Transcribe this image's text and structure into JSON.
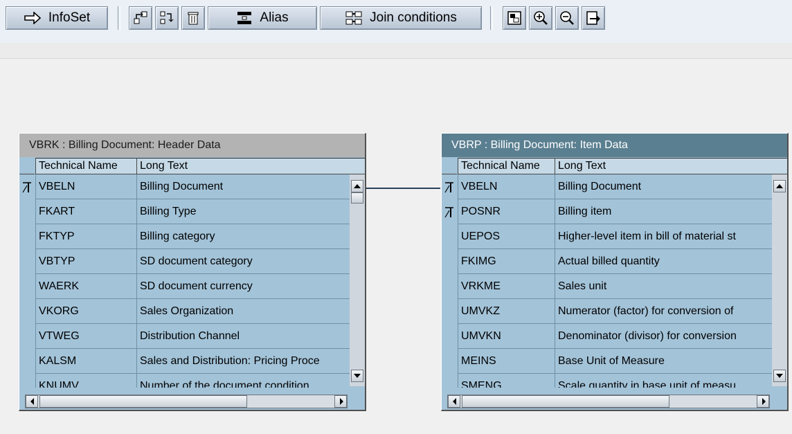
{
  "toolbar": {
    "infoset_label": "InfoSet",
    "alias_label": "Alias",
    "join_conditions_label": "Join conditions"
  },
  "left_table": {
    "title": "VBRK : Billing Document: Header Data",
    "columns": [
      "Technical Name",
      "Long Text"
    ],
    "rows": [
      {
        "tech": "VBELN",
        "text": "Billing Document",
        "key": true
      },
      {
        "tech": "FKART",
        "text": "Billing Type",
        "key": false
      },
      {
        "tech": "FKTYP",
        "text": "Billing category",
        "key": false
      },
      {
        "tech": "VBTYP",
        "text": "SD document category",
        "key": false
      },
      {
        "tech": "WAERK",
        "text": "SD document currency",
        "key": false
      },
      {
        "tech": "VKORG",
        "text": "Sales Organization",
        "key": false
      },
      {
        "tech": "VTWEG",
        "text": "Distribution Channel",
        "key": false
      },
      {
        "tech": "KALSM",
        "text": "Sales and Distribution: Pricing Proce",
        "key": false
      },
      {
        "tech": "KNUMV",
        "text": "Number of the document condition",
        "key": false
      }
    ]
  },
  "right_table": {
    "title": "VBRP : Billing Document: Item Data",
    "columns": [
      "Technical Name",
      "Long Text"
    ],
    "rows": [
      {
        "tech": "VBELN",
        "text": "Billing Document",
        "key": true
      },
      {
        "tech": "POSNR",
        "text": "Billing item",
        "key": true
      },
      {
        "tech": "UEPOS",
        "text": "Higher-level item in bill of material st",
        "key": false
      },
      {
        "tech": "FKIMG",
        "text": "Actual billed quantity",
        "key": false
      },
      {
        "tech": "VRKME",
        "text": "Sales unit",
        "key": false
      },
      {
        "tech": "UMVKZ",
        "text": "Numerator (factor) for conversion of",
        "key": false
      },
      {
        "tech": "UMVKN",
        "text": "Denominator (divisor) for conversion",
        "key": false
      },
      {
        "tech": "MEINS",
        "text": "Base Unit of Measure",
        "key": false
      },
      {
        "tech": "SMENG",
        "text": "Scale quantity in base unit of measu",
        "key": false
      }
    ]
  },
  "icons": {
    "infoset": "arrow-right-icon",
    "tree_up": "hierarchy-up-icon",
    "tree_down": "hierarchy-down-icon",
    "delete": "trash-icon",
    "alias": "alias-icon",
    "join": "join-conditions-icon",
    "overview": "overview-icon",
    "zoom_in": "zoom-in-icon",
    "zoom_out": "zoom-out-icon",
    "export": "export-icon",
    "key": "key-field-icon"
  },
  "colors": {
    "table_bg": "#a3c3d8",
    "left_title_bg": "#b3b3b3",
    "right_title_bg": "#5a7f90",
    "join_line": "#27415a"
  }
}
